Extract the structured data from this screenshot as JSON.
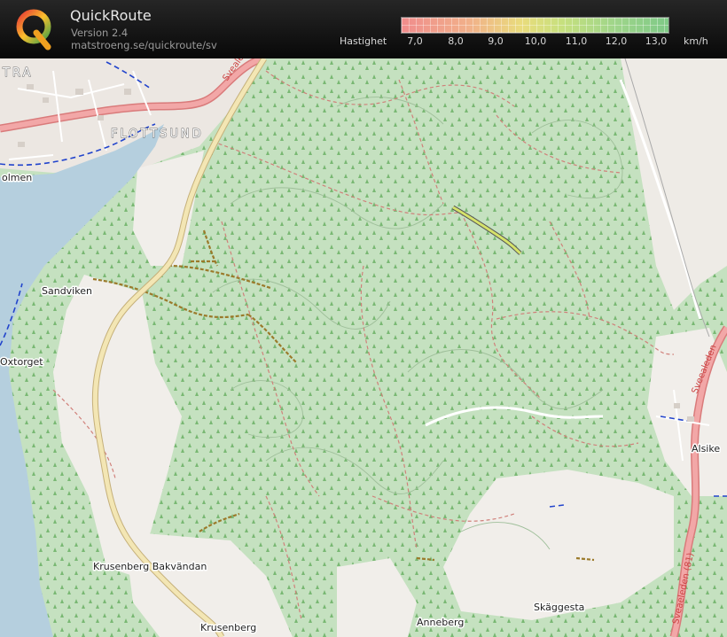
{
  "app": {
    "title": "QuickRoute",
    "version": "Version 2.4",
    "url": "matstroeng.se/quickroute/sv"
  },
  "speed_scale": {
    "label": "Hastighet",
    "ticks": [
      "7,0",
      "8,0",
      "9,0",
      "10,0",
      "11,0",
      "12,0",
      "13,0"
    ],
    "unit": "km/h",
    "colors": {
      "slow": "#f08c8c",
      "mid": "#e9dc7c",
      "fast": "#7fc987"
    }
  },
  "map": {
    "places": {
      "tra": "TRA",
      "flottsund": "FLOTTSUND",
      "olmen": "olmen",
      "sandviken": "Sandviken",
      "oxtorget": "Oxtorget",
      "alsike": "Alsike",
      "krusenberg_bakvandan": "Krusenberg Bakvändan",
      "krusenberg": "Krusenberg",
      "anneberg": "Anneberg",
      "skaggesta": "Skäggesta"
    },
    "roads": {
      "svealeden_top": "Sveale",
      "svealeden_right": "Sveealeden",
      "svealeden_bottom": "Sveaeleden (81)"
    },
    "colors": {
      "forest": "#c5e1c0",
      "open": "#f1eeea",
      "water": "#b5cfde",
      "main_road": "#f2a7a7",
      "track": "#d5e26a"
    }
  }
}
